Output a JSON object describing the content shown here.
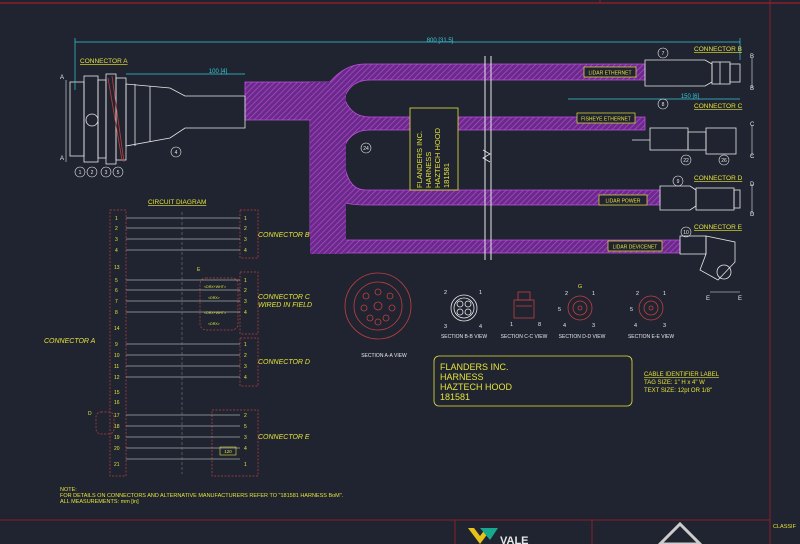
{
  "dimensions": {
    "overall": "800 [31.5]",
    "connector_a_length": "100 [4]",
    "connector_c_offset": "150 [6]"
  },
  "connectors": {
    "a": "CONNECTOR A",
    "b": "CONNECTOR B",
    "c": "CONNECTOR C",
    "d": "CONNECTOR D",
    "e": "CONNECTOR E"
  },
  "section_markers": {
    "a": "A",
    "b": "B",
    "c": "C",
    "d": "D",
    "e": "E"
  },
  "cable_labels": {
    "lidar_ethernet": "LIDAR ETHERNET",
    "fisheye_ethernet": "FISHEYE ETHERNET",
    "lidar_power": "LIDAR POWER",
    "lidar_devicenet": "LIDAR DEVICENET"
  },
  "hood_tag": {
    "line1": "FLANDERS INC.",
    "line2": "HARNESS",
    "line3": "HAZTECH HOOD",
    "line4": "181581"
  },
  "balloons": {
    "b1": "1",
    "b2": "2",
    "b3": "3",
    "b4": "4",
    "b5": "5",
    "b6": "6",
    "b7": "7",
    "b8": "8",
    "b9": "9",
    "b10": "10",
    "b22": "22",
    "b24": "24",
    "b26": "26"
  },
  "circuit": {
    "title": "CIRCUIT DIAGRAM",
    "connector_a_label": "CONNECTOR A",
    "connector_b_label": "CONNECTOR B",
    "connector_c_label": "CONNECTOR C",
    "connector_c_sub": "WIRED IN FIELD",
    "connector_d_label": "CONNECTOR D",
    "connector_e_label": "CONNECTOR E",
    "note_e": "E",
    "note_d": "D",
    "resistor": "120",
    "c_pins": [
      "<DRX+WHT>",
      "<DRX>",
      "<DRX+WHT>",
      "<DRX>"
    ],
    "a_pins": [
      "1",
      "2",
      "3",
      "4",
      "13",
      "5",
      "6",
      "7",
      "8",
      "14",
      "9",
      "10",
      "11",
      "12",
      "15",
      "16",
      "17",
      "18",
      "19",
      "20",
      "21"
    ],
    "b_pins": [
      "1",
      "2",
      "3",
      "4"
    ],
    "c_pins_num": [
      "1",
      "2",
      "3",
      "4"
    ],
    "d_pins": [
      "1",
      "2",
      "3",
      "4"
    ],
    "e_pins": [
      "2",
      "5",
      "3",
      "4",
      "1"
    ]
  },
  "sections": {
    "a": "SECTION A-A VIEW",
    "b": "SECTION B-B VIEW",
    "c": "SECTION C-C VIEW",
    "d": "SECTION D-D VIEW",
    "e": "SECTION E-E VIEW",
    "b_pins": [
      "2",
      "1",
      "3",
      "4"
    ],
    "c_pins": [
      "1",
      "8"
    ],
    "d_pins": [
      "1",
      "2",
      "5",
      "3",
      "4"
    ],
    "e_pins": [
      "1",
      "2",
      "5",
      "3",
      "4"
    ],
    "d_note": "G"
  },
  "label_block": {
    "line1": "FLANDERS INC.",
    "line2": "HARNESS",
    "line3": "HAZTECH HOOD",
    "line4": "181581",
    "spec_title": "CABLE IDENTIFIER LABEL",
    "spec_size": "TAG SIZE: 1\" H x 4\" W",
    "spec_text": "TEXT SIZE: 12pt OR 1/8\""
  },
  "notes": {
    "line1": "NOTE:",
    "line2": "FOR DETAILS ON CONNECTORS AND ALTERNATIVE MANUFACTURERS REFER TO \"181581 HARNESS BoM\".",
    "line3": "ALL MEASUREMENTS: mm [in]"
  },
  "title_block": {
    "logo": "VALE",
    "classification": "CLASSIF"
  },
  "colors": {
    "background": "#1f2430",
    "cable": "#6a2a8a",
    "cable_hatch": "#b04ad0",
    "label": "#e6e23a",
    "linework": "#e8e8e8",
    "dimension": "#39c9d8",
    "border": "#8a1f2a"
  }
}
